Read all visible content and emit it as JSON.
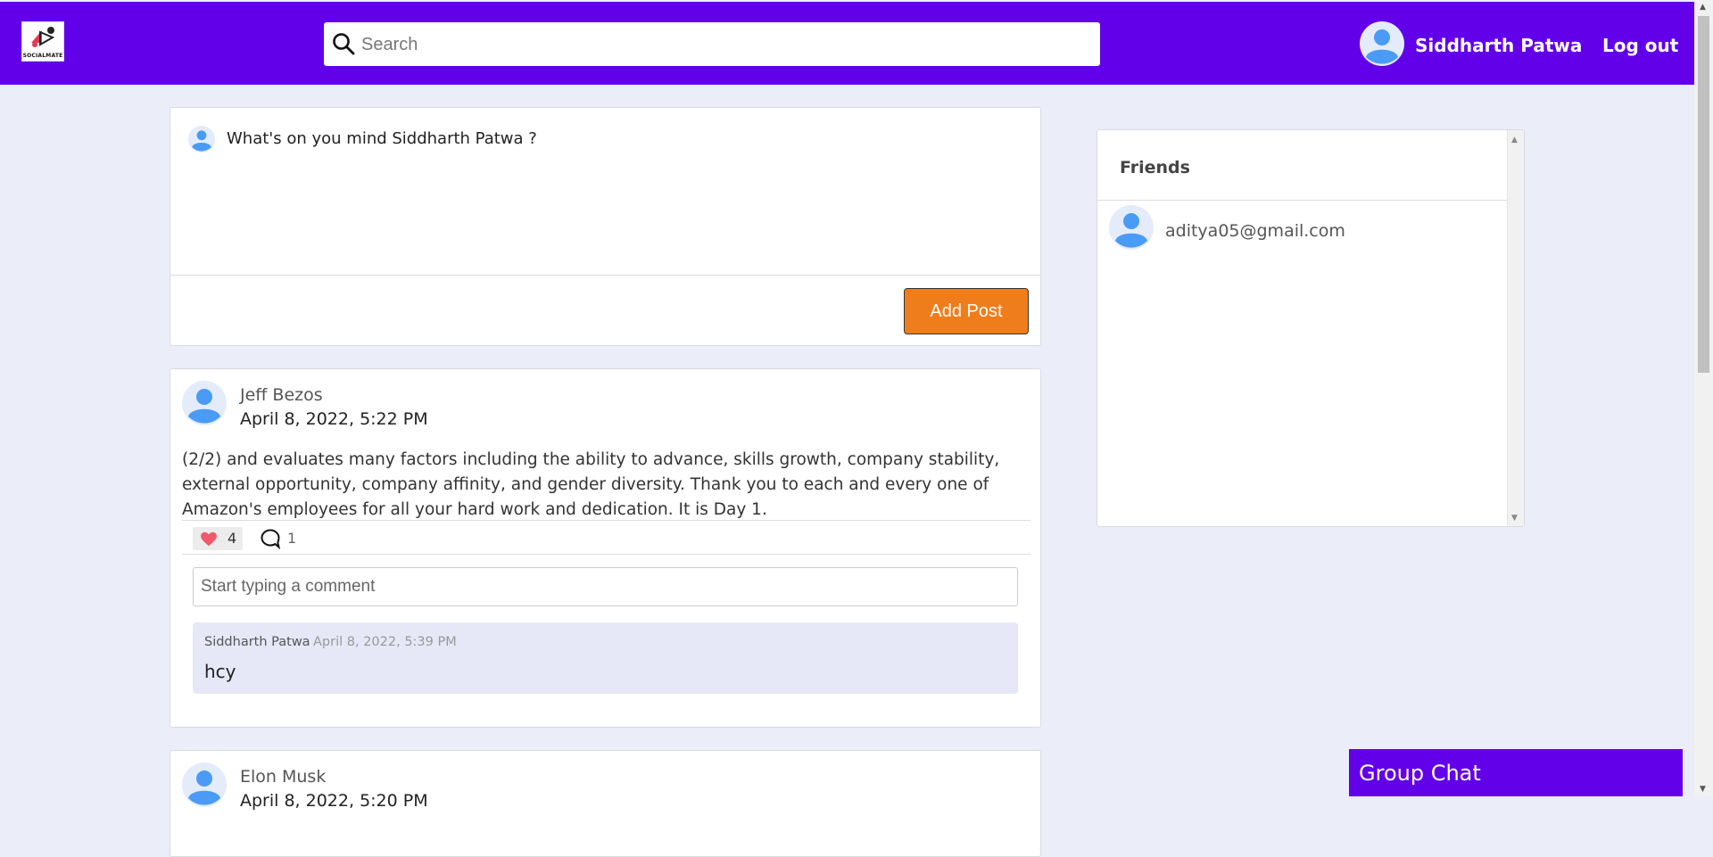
{
  "header": {
    "logo_text": "SOCIALMATE",
    "search_placeholder": "Search",
    "user_name": "Siddharth Patwa",
    "logout_label": "Log out"
  },
  "composer": {
    "prompt": "What's on you mind Siddharth Patwa ?",
    "add_post_label": "Add Post"
  },
  "posts": [
    {
      "author": "Jeff Bezos",
      "date": "April 8, 2022, 5:22 PM",
      "text": "(2/2) and evaluates many factors including the ability to advance, skills growth, company stability, external opportunity, company affinity, and gender diversity. Thank you to each and every one of Amazon's employees for all your hard work and dedication. It is Day 1.",
      "likes": "4",
      "comment_count": "1",
      "comment_placeholder": "Start typing a comment",
      "comments": [
        {
          "author": "Siddharth Patwa",
          "time": "April 8, 2022, 5:39 PM",
          "text": "hcy"
        }
      ]
    },
    {
      "author": "Elon Musk",
      "date": "April 8, 2022, 5:20 PM"
    }
  ],
  "friends": {
    "title": "Friends",
    "items": [
      {
        "email": "aditya05@gmail.com"
      }
    ]
  },
  "group_chat": {
    "label": "Group Chat"
  },
  "colors": {
    "brand": "#6200ea",
    "accent_button": "#f07d1b",
    "page_bg": "#ebeef8",
    "avatar": "#4a9bf5"
  }
}
